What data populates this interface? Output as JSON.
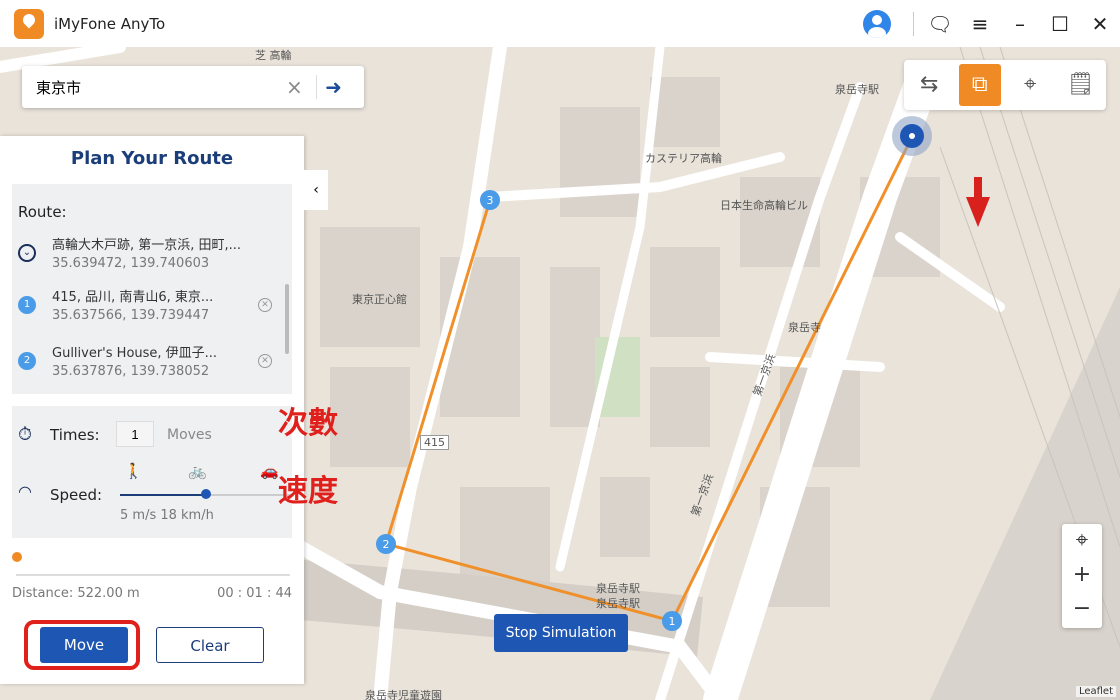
{
  "app": {
    "title": "iMyFone AnyTo"
  },
  "titlebar": {
    "icons": [
      "user-avatar-icon",
      "feedback-icon",
      "menu-icon",
      "minimize-icon",
      "maximize-icon",
      "close-icon"
    ]
  },
  "search": {
    "value": "東京市",
    "placeholder": ""
  },
  "panel": {
    "title": "Plan Your Route",
    "route_label": "Route:",
    "points": [
      {
        "name": "高輪大木戸跡, 第一京浜, 田町,...",
        "coords": "35.639472, 139.740603",
        "marker": "start"
      },
      {
        "name": "415, 品川, 南青山6, 東京...",
        "coords": "35.637566, 139.739447",
        "marker": "1"
      },
      {
        "name": "Gulliver's House, 伊皿子...",
        "coords": "35.637876, 139.738052",
        "marker": "2"
      }
    ],
    "times_label": "Times:",
    "times_value": "1",
    "times_unit": "Moves",
    "speed_label": "Speed:",
    "speed_value": "5 m/s 18 km/h",
    "speed_fraction": 0.5,
    "distance": "Distance: 522.00 m",
    "duration": "00 : 01 : 44",
    "progress": 0,
    "move_label": "Move",
    "clear_label": "Clear"
  },
  "annotations": {
    "times": "次數",
    "speed": "速度"
  },
  "map": {
    "stop_label": "Stop Simulation",
    "labels": [
      "泉岳寺駅",
      "東京正心館",
      "カステリア高輪",
      "日本生命高輪ビル",
      "泉岳寺",
      "第一京浜",
      "第一京浜",
      "415",
      "泉岳寺駅",
      "泉岳寺児童遊園",
      "芝 高輪",
      "泉岳寺駅"
    ],
    "waypoints": [
      "1",
      "2",
      "3"
    ],
    "attribution": "Leaflet",
    "tools": [
      "two-point-route-icon",
      "multi-spot-route-icon",
      "teleport-icon",
      "history-icon"
    ],
    "active_tool": "multi-spot-route-icon",
    "accent": "#f08a24",
    "route_color": "#f0902a"
  }
}
